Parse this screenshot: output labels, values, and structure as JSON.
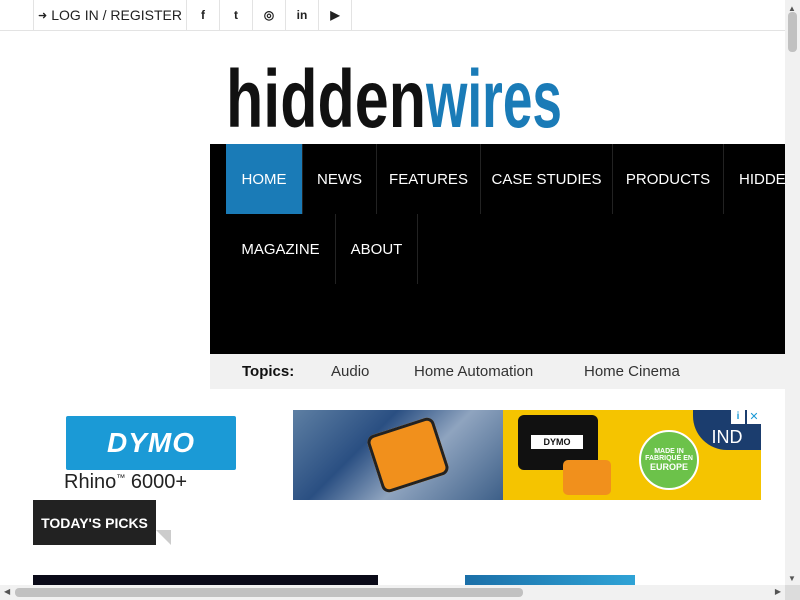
{
  "topbar": {
    "login_icon": "sign-in-icon",
    "login_label": "LOG IN / REGISTER",
    "social": [
      {
        "name": "facebook-icon",
        "glyph": "f"
      },
      {
        "name": "twitter-icon",
        "glyph": "t"
      },
      {
        "name": "instagram-icon",
        "glyph": "◎"
      },
      {
        "name": "linkedin-icon",
        "glyph": "in"
      },
      {
        "name": "youtube-icon",
        "glyph": "▶"
      }
    ]
  },
  "logo": {
    "part1": "hidden",
    "part2": "wires",
    "color_dark": "#111111",
    "color_accent": "#1a7bb7"
  },
  "nav": {
    "items": [
      "HOME",
      "NEWS",
      "FEATURES",
      "CASE STUDIES",
      "PRODUCTS",
      "HIDDE",
      "MAGAZINE",
      "ABOUT"
    ],
    "active_index": 0,
    "active_color": "#1a7bb7"
  },
  "topics": {
    "label": "Topics:",
    "items": [
      "Audio",
      "Home Automation",
      "Home Cinema"
    ]
  },
  "ad_left": {
    "brand": "DYMO",
    "product": "Rhino",
    "tm": "™",
    "model": "6000+"
  },
  "ad_banner": {
    "case_label": "DYMO",
    "badge_line1": "MADE IN",
    "badge_line2": "FABRIQUÉ EN",
    "badge_line3": "EUROPE",
    "corner_text": "IND",
    "close_glyph": "✕",
    "info_glyph": "i"
  },
  "picks": {
    "label": "TODAY'S PICKS"
  },
  "scrollbar": {
    "up": "▲",
    "down": "▼",
    "left": "◀",
    "right": "▶"
  }
}
